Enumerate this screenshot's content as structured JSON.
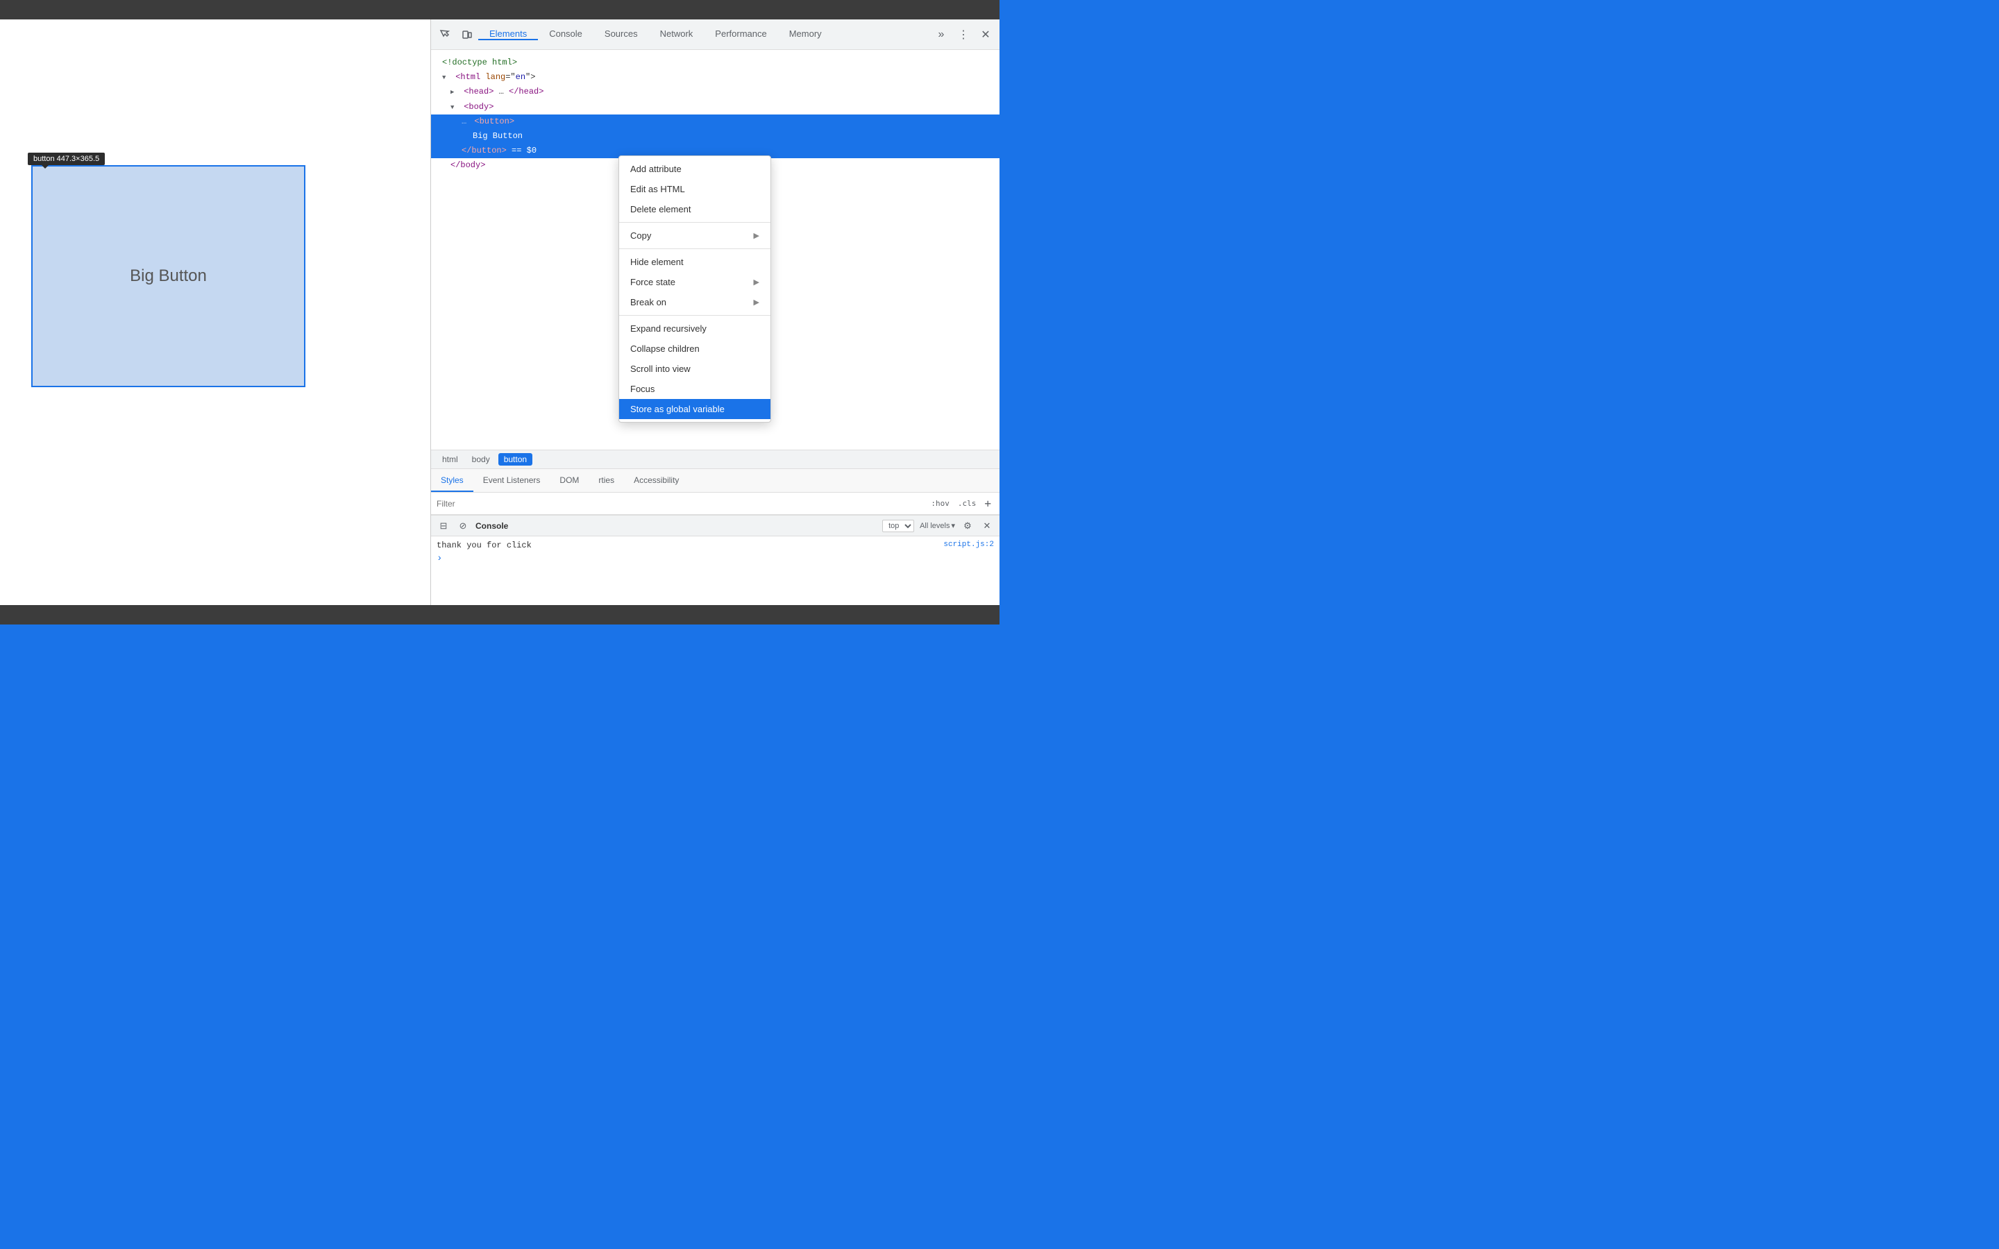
{
  "browser": {
    "top_bar_color": "#3c3c3c",
    "bottom_bar_color": "#3c3c3c",
    "page_bg": "#1a73e8"
  },
  "page": {
    "button_text": "Big Button",
    "tooltip_text": "button  447.3×365.5"
  },
  "devtools": {
    "tabs": [
      {
        "label": "Elements",
        "active": true
      },
      {
        "label": "Console",
        "active": false
      },
      {
        "label": "Sources",
        "active": false
      },
      {
        "label": "Network",
        "active": false
      },
      {
        "label": "Performance",
        "active": false
      },
      {
        "label": "Memory",
        "active": false
      }
    ],
    "dom": {
      "lines": [
        {
          "text": "<!doctype html>",
          "type": "comment",
          "indent": 0
        },
        {
          "text": "<html lang=\"en\">",
          "type": "tag",
          "indent": 0
        },
        {
          "text": "▶ <head>…</head>",
          "type": "collapsed",
          "indent": 1
        },
        {
          "text": "▼ <body>",
          "type": "open",
          "indent": 1
        },
        {
          "text": "…    <button>",
          "type": "selected",
          "indent": 2
        },
        {
          "text": "Big Button",
          "type": "text-selected",
          "indent": 3
        },
        {
          "text": "</button> == $0",
          "type": "selected-end",
          "indent": 2
        },
        {
          "text": "</body>",
          "type": "close",
          "indent": 1
        }
      ]
    },
    "breadcrumb": {
      "items": [
        {
          "label": "html",
          "active": false
        },
        {
          "label": "body",
          "active": false
        },
        {
          "label": "button",
          "active": true
        }
      ]
    },
    "sub_tabs": [
      {
        "label": "Styles",
        "active": true
      },
      {
        "label": "Event Listeners",
        "active": false
      },
      {
        "label": "DOM",
        "active": false
      },
      {
        "label": "rties",
        "active": false
      },
      {
        "label": "Accessibility",
        "active": false
      }
    ],
    "filter": {
      "placeholder": "Filter",
      "hov_btn": ":hov",
      "cls_btn": ".cls",
      "add_btn": "+"
    },
    "console": {
      "label": "Console",
      "context": "top",
      "levels_label": "All levels",
      "log_line": "thank you for click",
      "source": "script.js:2"
    }
  },
  "context_menu": {
    "items": [
      {
        "label": "Add attribute",
        "has_submenu": false
      },
      {
        "label": "Edit as HTML",
        "has_submenu": false
      },
      {
        "label": "Delete element",
        "has_submenu": false
      },
      {
        "separator": true
      },
      {
        "label": "Copy",
        "has_submenu": true
      },
      {
        "separator": true
      },
      {
        "label": "Hide element",
        "has_submenu": false
      },
      {
        "label": "Force state",
        "has_submenu": true
      },
      {
        "label": "Break on",
        "has_submenu": true
      },
      {
        "separator": true
      },
      {
        "label": "Expand recursively",
        "has_submenu": false
      },
      {
        "label": "Collapse children",
        "has_submenu": false
      },
      {
        "label": "Scroll into view",
        "has_submenu": false
      },
      {
        "label": "Focus",
        "has_submenu": false
      },
      {
        "separator": false
      },
      {
        "label": "Store as global variable",
        "has_submenu": false,
        "highlighted": true
      }
    ]
  }
}
